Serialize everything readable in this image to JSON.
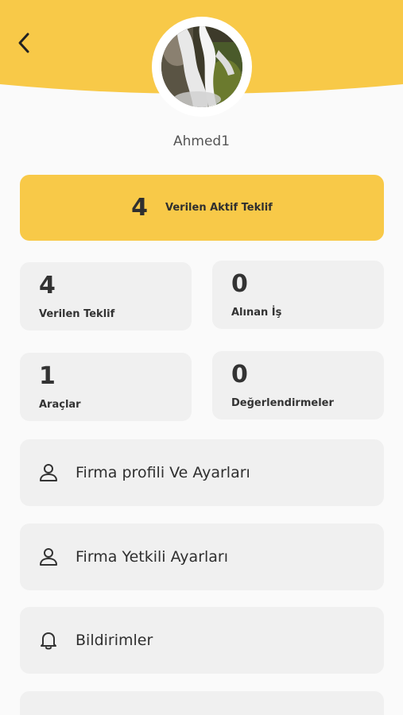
{
  "colors": {
    "accent": "#f8c948",
    "background": "#fafafa",
    "card": "#f0f0f0",
    "text": "#2f2f2f"
  },
  "header": {
    "back_icon": "chevron-left-icon",
    "avatar_image": "waterfall-photo"
  },
  "profile": {
    "username": "Ahmed1"
  },
  "active_offers": {
    "value": "4",
    "label": "Verilen Aktif Teklif"
  },
  "stats": [
    {
      "value": "4",
      "label": "Verilen Teklif"
    },
    {
      "value": "0",
      "label": "Alınan İş"
    },
    {
      "value": "1",
      "label": "Araçlar"
    },
    {
      "value": "0",
      "label": "Değerlendirmeler"
    }
  ],
  "menu": [
    {
      "label": "Firma profili Ve Ayarları",
      "icon": "user-icon"
    },
    {
      "label": "Firma Yetkili Ayarları",
      "icon": "user-icon"
    },
    {
      "label": "Bildirimler",
      "icon": "bell-icon"
    }
  ]
}
